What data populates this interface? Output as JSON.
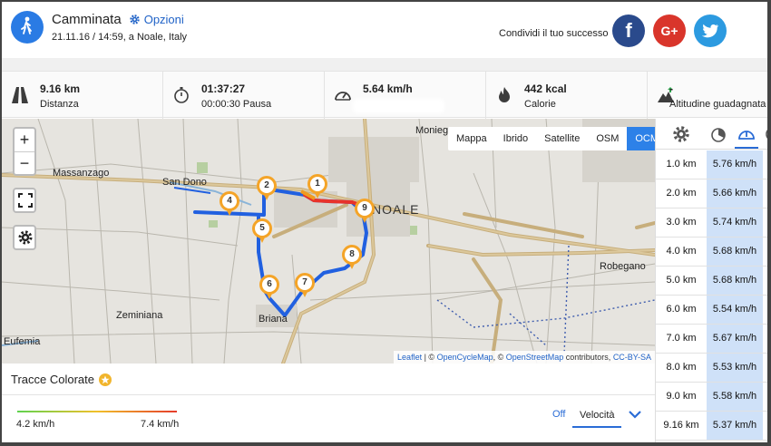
{
  "header": {
    "activity_title": "Camminata",
    "options_label": "Opzioni",
    "subtitle": "21.11.16 / 14:59, a Noale, Italy",
    "share_label": "Condividi il tuo successo",
    "social": [
      {
        "name": "facebook",
        "glyph": "f",
        "color": "#2a4a8c"
      },
      {
        "name": "google-plus",
        "glyph": "G+",
        "color": "#d9352b"
      },
      {
        "name": "twitter",
        "glyph": "t",
        "color": "#2c9ae0"
      }
    ]
  },
  "stats": [
    {
      "icon": "road-icon",
      "value": "9.16 km",
      "label": "Distanza"
    },
    {
      "icon": "stopwatch-icon",
      "value": "01:37:27",
      "label": "00:00:30 Pausa"
    },
    {
      "icon": "speedometer-icon",
      "value": "5.64 km/h",
      "label": ""
    },
    {
      "icon": "flame-icon",
      "value": "442 kcal",
      "label": "Calorie"
    },
    {
      "icon": "altitude-icon",
      "value": "-",
      "label": "Altitudine guadagnata"
    }
  ],
  "map": {
    "zoom_in": "+",
    "zoom_out": "−",
    "layers": [
      "Mappa",
      "Ibrido",
      "Satellite",
      "OSM",
      "OCM"
    ],
    "active_layer": "OCM",
    "place_labels": [
      "Moniego",
      "Massanzago",
      "San Dono",
      "NOALE",
      "Robegano",
      "Zeminiana",
      "Briana",
      "Eufemia"
    ],
    "markers": [
      "1",
      "2",
      "4",
      "5",
      "6",
      "7",
      "8",
      "9"
    ],
    "attribution": {
      "leaflet": "Leaflet",
      "sep1": " | © ",
      "ocm": "OpenCycleMap",
      "sep2": ", © ",
      "osm": "OpenStreetMap",
      "contrib": " contributors, ",
      "license": "CC-BY-SA"
    },
    "route_color": "#2160e0",
    "fast_color": "#e8322a"
  },
  "splits": [
    {
      "km": "1.0 km",
      "speed": "5.76 km/h"
    },
    {
      "km": "2.0 km",
      "speed": "5.66 km/h"
    },
    {
      "km": "3.0 km",
      "speed": "5.74 km/h"
    },
    {
      "km": "4.0 km",
      "speed": "5.68 km/h"
    },
    {
      "km": "5.0 km",
      "speed": "5.68 km/h"
    },
    {
      "km": "6.0 km",
      "speed": "5.54 km/h"
    },
    {
      "km": "7.0 km",
      "speed": "5.67 km/h"
    },
    {
      "km": "8.0 km",
      "speed": "5.53 km/h"
    },
    {
      "km": "9.0 km",
      "speed": "5.58 km/h"
    },
    {
      "km": "9.16 km",
      "speed": "5.37 km/h"
    }
  ],
  "tracks": {
    "title": "Tracce Colorate",
    "min_label": "4.2 km/h",
    "max_label": "7.4 km/h",
    "off_label": "Off",
    "selected": "Velocità"
  }
}
